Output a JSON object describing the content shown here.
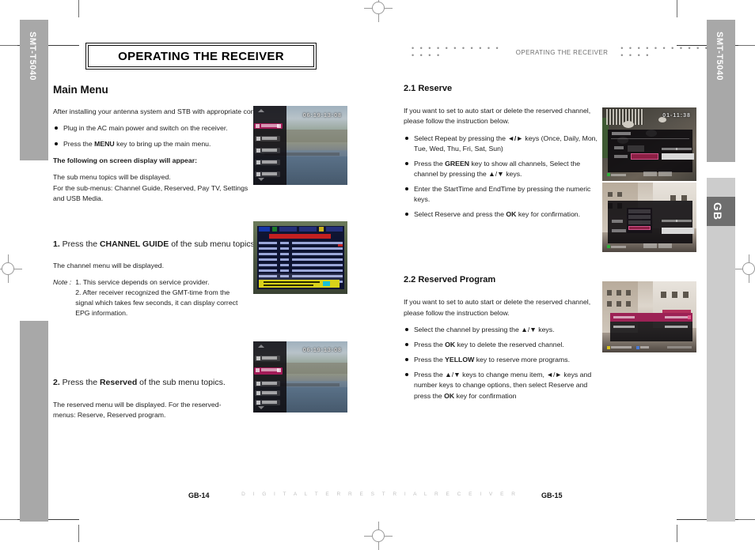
{
  "document": {
    "chapter_title": "OPERATING THE RECEIVER",
    "running_head": "OPERATING THE RECEIVER",
    "running_dots": "• • • • • • • • • • • • • • •",
    "model_tab_left": "SMT-T5040",
    "model_tab_right": "SMT-T5040",
    "language_tab": "GB",
    "footer_brand": "D I G I T A L   T E R R E S T R I A L   R E C E I V E R",
    "page_left": "GB-14",
    "page_right": "GB-15"
  },
  "left_column": {
    "heading": "Main Menu",
    "intro": "After installing your antenna system and STB with appropriate connectors.",
    "bullets": [
      {
        "pre": "Plug in the AC main power and switch on the receiver.",
        "bold": "",
        "post": ""
      },
      {
        "pre": "Press the ",
        "bold": "MENU",
        "post": " key to bring up the main menu."
      }
    ],
    "bold_line": "The following on screen display will appear:",
    "submenu_line1": "The sub menu topics will be displayed.",
    "submenu_line2": "For the sub-menus:  Channel Guide, Reserved, Pay TV, Settings",
    "submenu_line3": "and USB Media.",
    "step1": {
      "num": "1.",
      "pre": " Press the ",
      "bold": "CHANNEL GUIDE",
      "post": " of the sub menu topics."
    },
    "step1_body": "The channel menu will be displayed.",
    "note_label": "Note :",
    "note_items": [
      "1. This service depends on service provider.",
      "2. After receiver recognized the GMT-time from the",
      "signal which takes few seconds, it can display correct",
      "EPG information."
    ],
    "step2": {
      "num": "2.",
      "pre": " Press the ",
      "bold": "Reserved",
      "post": " of the sub menu topics."
    },
    "step2_body_line1": "The reserved menu will be displayed.  For the reserved-",
    "step2_body_line2": "menus: Reserve, Reserved program."
  },
  "right_column": {
    "section1": {
      "heading": "2.1 Reserve",
      "intro_line1": "If you want to set to auto start or delete the reserved channel,",
      "intro_line2": "please follow the instruction below.",
      "bullets": [
        {
          "pre": "Select Repeat by pressing the ",
          "bold": "◄/►",
          "post": " keys (Once, Daily, Mon, Tue, Wed, Thu, Fri, Sat, Sun)"
        },
        {
          "pre": "Press the ",
          "bold": "GREEN",
          "post": " key to show all channels, Select the channel by pressing the ▲/▼ keys."
        },
        {
          "pre": "Enter the StartTime and EndTime by pressing the numeric keys.",
          "bold": "",
          "post": ""
        },
        {
          "pre": "Select Reserve and press the ",
          "bold": "OK",
          "post": " key for confirmation."
        }
      ]
    },
    "section2": {
      "heading": "2.2 Reserved Program",
      "intro_line1": "If you want to set to auto start or delete the reserved channel,",
      "intro_line2": "please follow the instruction below.",
      "bullets": [
        {
          "pre": "Select the channel by pressing the ▲/▼ keys.",
          "bold": "",
          "post": ""
        },
        {
          "pre": "Press the ",
          "bold": "OK",
          "post": " key to delete the reserved channel."
        },
        {
          "pre": "Press the ",
          "bold": "YELLOW",
          "post": " key to reserve more programs."
        },
        {
          "pre": "Press the ▲/▼ keys to change menu item, ◄/► keys and number keys to change options, then select Reserve and press the ",
          "bold": "OK",
          "post": " key for confirmation"
        }
      ]
    }
  },
  "screenshots": {
    "main_menu": {
      "caption": "main-menu-osd",
      "clock": "06:19:13:08"
    },
    "channel_guide": {
      "caption": "channel-guide-epg"
    },
    "reserve_dialog": {
      "caption": "reserve-dialog",
      "clock": "01-11:38"
    },
    "reserve_channel_list": {
      "caption": "reserve-channel-list"
    },
    "reserved_program": {
      "caption": "reserved-program-list"
    }
  },
  "colors": {
    "tab_dark": "#a8a8a8",
    "tab_light": "#cccccc",
    "gb_tab": "#6e6e6e",
    "osd_accent": "#a31b57",
    "epg_red": "#c32020",
    "epg_yellow": "#d9d21a"
  }
}
